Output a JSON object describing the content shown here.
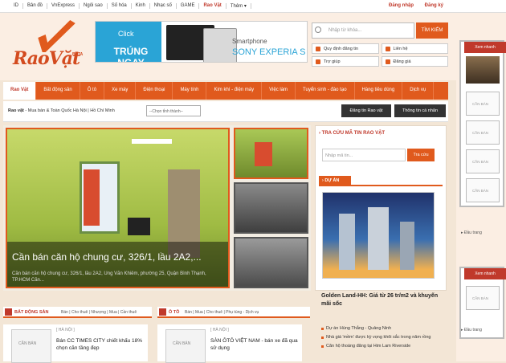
{
  "topbar": {
    "links": [
      "ID",
      "Bản đồ",
      "VnExpress",
      "Ngôi sao",
      "Số hóa",
      "Kinh",
      "Nhạc số",
      "GAME",
      "Rao Vặt",
      "Thêm ▾"
    ],
    "login": "Đăng nhập",
    "register": "Đăng ký"
  },
  "logo": {
    "text": "RaoVặt",
    "beta": "BETA"
  },
  "banner": {
    "click": "Click",
    "win": "TRÚNG NGAY",
    "product_1": "Smartphone",
    "product_2": "SONY EXPERIA S"
  },
  "search": {
    "placeholder": "Nhập từ khóa...",
    "button": "TÌM KIẾM"
  },
  "quick_links": [
    "Quy định đăng tin",
    "Liên hệ",
    "Trợ giúp",
    "Đăng giá"
  ],
  "nav": {
    "items": [
      "Rao Vặt",
      "Bất động sản",
      "Ô tô",
      "Xe máy",
      "Điện thoại",
      "Máy tính",
      "Kim khí - điện máy",
      "Việc làm",
      "Tuyển sinh - đào tạo",
      "Hàng tiêu dùng",
      "Dịch vụ"
    ],
    "active": 0
  },
  "subbar": {
    "crumb_bold": "Rao vặt",
    "crumb_rest": " - Mua bán & Toàn Quốc",
    "cities": "Hà Nội | Hồ Chí Minh",
    "select": "--Chọn tỉnh thành--",
    "post_btn": "Đăng tin Rao vặt",
    "personal_btn": "Thông tin cá nhân"
  },
  "slider": {
    "title": "Cần bán căn hộ chung cư, 326/1, lầu 2A2,...",
    "desc": "Cần bán căn hộ chung cư, 326/1, lầu 2A2, Ung Văn Khiêm, phường 25, Quận Bình Thạnh, TP.HCM Căn..."
  },
  "lookup": {
    "heading": "› TRA CỨU MÃ TIN RAO VẶT",
    "placeholder": "Nhập mã tin...",
    "button": "Tra cứu",
    "tab": "› DỰ ÁN"
  },
  "project": {
    "title": "Golden Land-HH: Giá từ 26 tr/m2 và khuyến mãi sốc"
  },
  "project_list": [
    "Dự án Hùng Thắng - Quảng Ninh",
    "Nhà giá 'mềm' được kỳ vọng khôi sắc trong năm rồng",
    "Căn hộ thoáng đãng tại Him Lam Riverside"
  ],
  "categories": [
    {
      "label": "BẤT ĐỘNG SẢN",
      "subs": "Bán | Cho thuê | Nhượng | Mua | Cần thuê"
    },
    {
      "label": "Ô TÔ",
      "subs": "Bán | Mua | Cho thuê | Phụ tùng - Dịch vụ"
    }
  ],
  "cards": [
    {
      "tag": "[ HÀ NỘI ]",
      "title": "Bán CC TIMES CITY chiết khấu 18% chọn căn tầng đẹp",
      "ph": "CẦN BÁN"
    },
    {
      "tag": "[ HÀ NỘI ]",
      "title": "SÀN ÔTÔ VIỆT NAM - bán xe đã qua sử dụng",
      "ph": "CẦN BÁN"
    }
  ],
  "sidebar": {
    "block1_title": "Xem nhanh",
    "block2_title": "Xem nhanh",
    "ph_label": "CẦN BÁN",
    "more": "▸ Đầu trang"
  }
}
